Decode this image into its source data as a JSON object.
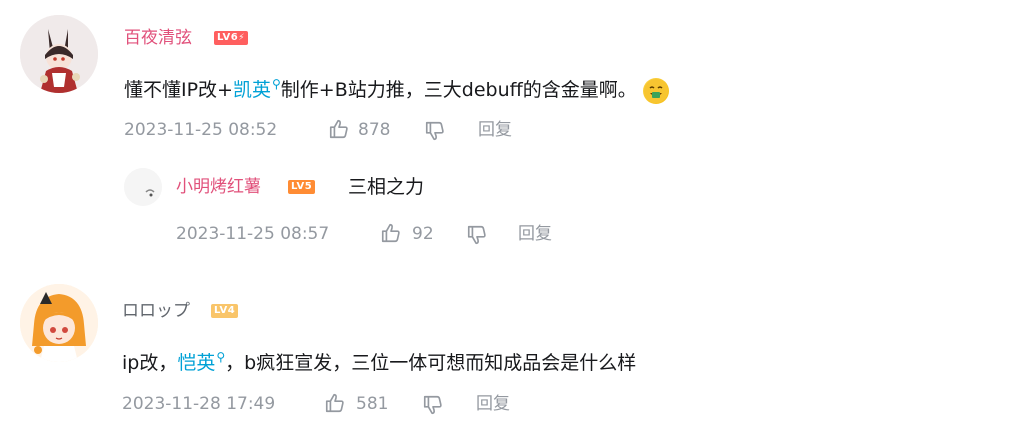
{
  "comments": [
    {
      "username": "百夜清弦",
      "level": "LV6",
      "text_parts": [
        "懂不懂IP改+",
        "凯英",
        "制作+B站力推，三大debuff的含金量啊。"
      ],
      "emoji": "smile-money-emoji",
      "time": "2023-11-25 08:52",
      "likes": "878",
      "reply_label": "回复",
      "replies": [
        {
          "username": "小明烤红薯",
          "level": "LV5",
          "text": "三相之力",
          "time": "2023-11-25 08:57",
          "likes": "92",
          "reply_label": "回复"
        }
      ]
    },
    {
      "username": "ロロップ",
      "level": "LV4",
      "text_parts": [
        "ip改，",
        "恺英",
        "，b疯狂宣发，三位一体可想而知成品会是什么样"
      ],
      "time": "2023-11-28 17:49",
      "likes": "581",
      "reply_label": "回复"
    }
  ],
  "colors": {
    "username_pink": "#e1517b",
    "level_red": "#ff5f5f",
    "level_orange": "#ff8c34",
    "level_light": "#f9c56a",
    "meta_gray": "#9499a0",
    "link_blue": "#00a1d6"
  }
}
